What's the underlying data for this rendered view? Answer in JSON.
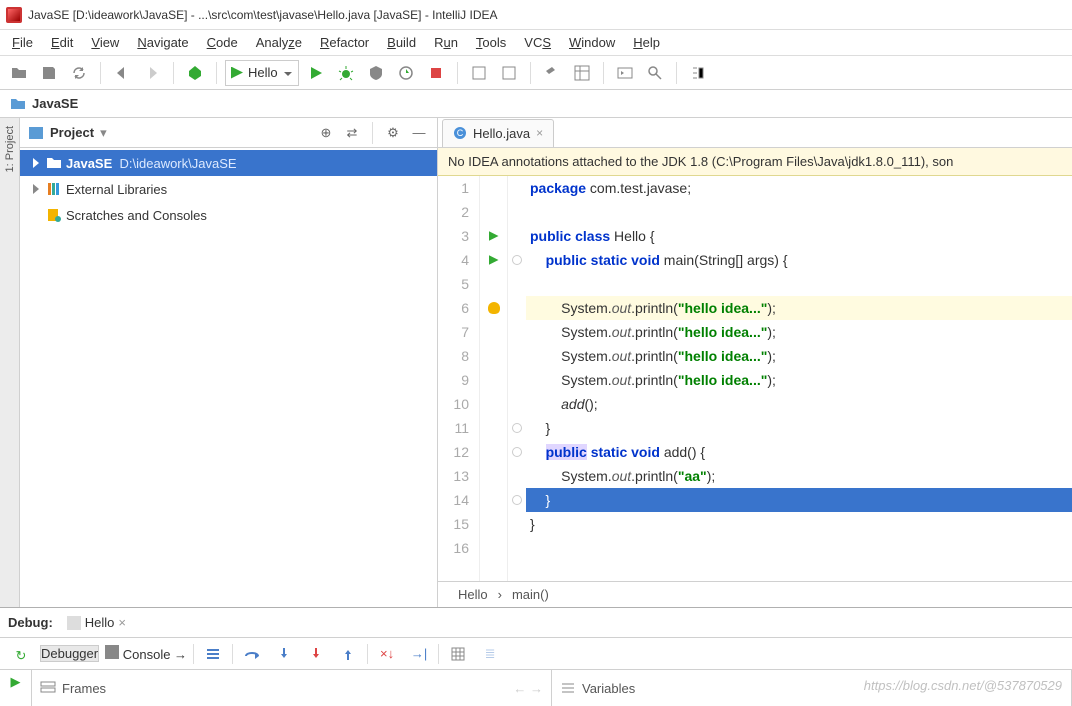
{
  "window": {
    "title": "JavaSE [D:\\ideawork\\JavaSE] - ...\\src\\com\\test\\javase\\Hello.java [JavaSE] - IntelliJ IDEA"
  },
  "menu": {
    "file": "File",
    "edit": "Edit",
    "view": "View",
    "navigate": "Navigate",
    "code": "Code",
    "analyze": "Analyze",
    "refactor": "Refactor",
    "build": "Build",
    "run": "Run",
    "tools": "Tools",
    "vcs": "VCS",
    "window": "Window",
    "help": "Help"
  },
  "toolbar": {
    "run_config": "Hello"
  },
  "crumb": {
    "project": "JavaSE"
  },
  "project_view": {
    "title": "Project",
    "rows": {
      "r0_name": "JavaSE",
      "r0_path": "D:\\ideawork\\JavaSE",
      "r1": "External Libraries",
      "r2": "Scratches and Consoles"
    }
  },
  "sidetab": {
    "label": "1: Project"
  },
  "editor": {
    "tab": "Hello.java",
    "warning": "No IDEA annotations attached to the JDK 1.8 (C:\\Program Files\\Java\\jdk1.8.0_111), son",
    "lines": {
      "l1": "package com.test.javase;",
      "l3": "public class Hello {",
      "l4": "    public static void main(String[] args) {",
      "l6": "        System.out.println(\"hello idea...\");",
      "l7": "        System.out.println(\"hello idea...\");",
      "l8": "        System.out.println(\"hello idea...\");",
      "l9": "        System.out.println(\"hello idea...\");",
      "l10": "        add();",
      "l11": "    }",
      "l12": "    public static void add() {",
      "l13": "        System.out.println(\"aa\");",
      "l14": "    }",
      "l15": "}"
    },
    "breadcrumb": {
      "class": "Hello",
      "method": "main()"
    }
  },
  "debug": {
    "label": "Debug:",
    "run_name": "Hello",
    "tabs": {
      "debugger": "Debugger",
      "console": "Console"
    },
    "panels": {
      "frames": "Frames",
      "variables": "Variables"
    }
  },
  "watermark": "https://blog.csdn.net/@537870529"
}
